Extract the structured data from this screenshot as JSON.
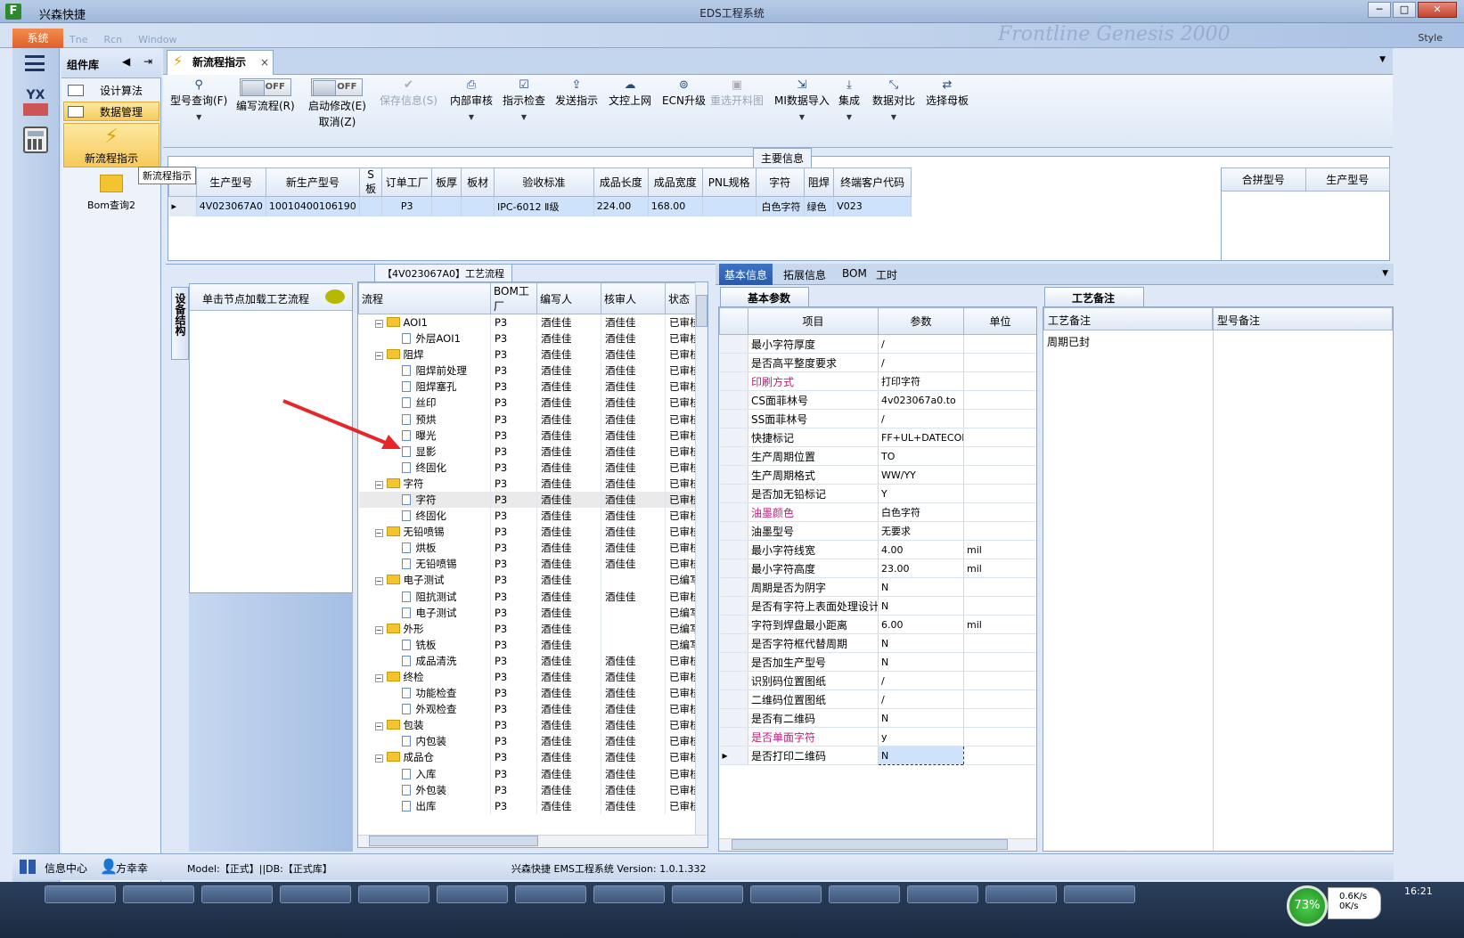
{
  "window": {
    "app_name": "兴森快捷",
    "title": "EDS工程系统",
    "style_label": "Style",
    "banner_text": "Frontline Genesis 2000"
  },
  "menu": {
    "system_button": "系统",
    "faint_items": [
      "Tne",
      "Rcn",
      "Window"
    ]
  },
  "component_library": {
    "title": "组件库",
    "items": [
      {
        "label": "设计算法"
      },
      {
        "label": "数据管理"
      },
      {
        "label": "新流程指示"
      },
      {
        "label": "Bom查询2"
      }
    ],
    "tooltip": "新流程指示"
  },
  "tab": {
    "label": "新流程指示"
  },
  "toolbar": {
    "buttons": [
      {
        "label": "型号查询(F)",
        "icon": "search-icon"
      },
      {
        "label": "编写流程(R)",
        "toggle": "OFF"
      },
      {
        "label": "启动修改(E)",
        "label2": "取消(Z)",
        "toggle": "OFF"
      },
      {
        "label": "保存信息(S)",
        "icon": "check-icon",
        "disabled": true
      },
      {
        "label": "内部审核",
        "icon": "printer-icon"
      },
      {
        "label": "指示检查",
        "icon": "checkbox-icon"
      },
      {
        "label": "发送指示",
        "icon": "upload-icon"
      },
      {
        "label": "文控上网",
        "icon": "cloud-upload-icon"
      },
      {
        "label": "ECN升级",
        "icon": "binoculars-icon"
      },
      {
        "label": "重选开料图",
        "icon": "image-icon",
        "disabled": true
      },
      {
        "label": "MI数据导入",
        "icon": "import-icon"
      },
      {
        "label": "集成",
        "icon": "download-icon"
      },
      {
        "label": "数据对比",
        "icon": "compress-icon"
      },
      {
        "label": "选择母板",
        "icon": "shuffle-icon"
      }
    ]
  },
  "main_info": {
    "title": "主要信息",
    "columns": [
      "生产型号",
      "新生产型号",
      "S板",
      "订单工厂",
      "板厚",
      "板材",
      "验收标准",
      "成品长度",
      "成品宽度",
      "PNL规格",
      "字符",
      "阻焊",
      "终端客户代码"
    ],
    "rows": [
      [
        "4V023067A0",
        "10010400106190",
        "",
        "P3",
        "",
        "",
        "IPC-6012 Ⅱ级",
        "224.00",
        "168.00",
        "",
        "白色字符",
        "绿色",
        "V023"
      ]
    ],
    "side_columns": [
      "合拼型号",
      "生产型号"
    ]
  },
  "left_panel": {
    "vertical_tab": "设备结构",
    "hint": "单击节点加载工艺流程"
  },
  "flow": {
    "title": "【4V023067A0】工艺流程",
    "columns": [
      "流程",
      "BOM工厂",
      "编写人",
      "核审人",
      "状态"
    ],
    "rows": [
      {
        "name": "AOI1",
        "level": 0,
        "folder": true,
        "factory": "P3",
        "writer": "酒佳佳",
        "reviewer": "酒佳佳",
        "status": "已审核"
      },
      {
        "name": "外层AOI1",
        "level": 1,
        "factory": "P3",
        "writer": "酒佳佳",
        "reviewer": "酒佳佳",
        "status": "已审核"
      },
      {
        "name": "阻焊",
        "level": 0,
        "folder": true,
        "factory": "P3",
        "writer": "酒佳佳",
        "reviewer": "酒佳佳",
        "status": "已审核"
      },
      {
        "name": "阻焊前处理",
        "level": 1,
        "factory": "P3",
        "writer": "酒佳佳",
        "reviewer": "酒佳佳",
        "status": "已审核"
      },
      {
        "name": "阻焊塞孔",
        "level": 1,
        "factory": "P3",
        "writer": "酒佳佳",
        "reviewer": "酒佳佳",
        "status": "已审核"
      },
      {
        "name": "丝印",
        "level": 1,
        "factory": "P3",
        "writer": "酒佳佳",
        "reviewer": "酒佳佳",
        "status": "已审核"
      },
      {
        "name": "预烘",
        "level": 1,
        "factory": "P3",
        "writer": "酒佳佳",
        "reviewer": "酒佳佳",
        "status": "已审核"
      },
      {
        "name": "曝光",
        "level": 1,
        "factory": "P3",
        "writer": "酒佳佳",
        "reviewer": "酒佳佳",
        "status": "已审核"
      },
      {
        "name": "显影",
        "level": 1,
        "factory": "P3",
        "writer": "酒佳佳",
        "reviewer": "酒佳佳",
        "status": "已审核"
      },
      {
        "name": "终固化",
        "level": 1,
        "factory": "P3",
        "writer": "酒佳佳",
        "reviewer": "酒佳佳",
        "status": "已审核"
      },
      {
        "name": "字符",
        "level": 0,
        "folder": true,
        "factory": "P3",
        "writer": "酒佳佳",
        "reviewer": "酒佳佳",
        "status": "已审核"
      },
      {
        "name": "字符",
        "level": 1,
        "factory": "P3",
        "writer": "酒佳佳",
        "reviewer": "酒佳佳",
        "status": "已审核",
        "selected": true
      },
      {
        "name": "终固化",
        "level": 1,
        "factory": "P3",
        "writer": "酒佳佳",
        "reviewer": "酒佳佳",
        "status": "已审核"
      },
      {
        "name": "无铅喷锡",
        "level": 0,
        "folder": true,
        "factory": "P3",
        "writer": "酒佳佳",
        "reviewer": "酒佳佳",
        "status": "已审核"
      },
      {
        "name": "烘板",
        "level": 1,
        "factory": "P3",
        "writer": "酒佳佳",
        "reviewer": "酒佳佳",
        "status": "已审核"
      },
      {
        "name": "无铅喷锡",
        "level": 1,
        "factory": "P3",
        "writer": "酒佳佳",
        "reviewer": "酒佳佳",
        "status": "已审核"
      },
      {
        "name": "电子测试",
        "level": 0,
        "folder": true,
        "factory": "P3",
        "writer": "酒佳佳",
        "reviewer": "",
        "status": "已编写"
      },
      {
        "name": "阻抗测试",
        "level": 1,
        "factory": "P3",
        "writer": "酒佳佳",
        "reviewer": "酒佳佳",
        "status": "已审核"
      },
      {
        "name": "电子测试",
        "level": 1,
        "factory": "P3",
        "writer": "酒佳佳",
        "reviewer": "",
        "status": "已编写"
      },
      {
        "name": "外形",
        "level": 0,
        "folder": true,
        "factory": "P3",
        "writer": "酒佳佳",
        "reviewer": "",
        "status": "已编写"
      },
      {
        "name": "铣板",
        "level": 1,
        "factory": "P3",
        "writer": "酒佳佳",
        "reviewer": "",
        "status": "已编写"
      },
      {
        "name": "成品清洗",
        "level": 1,
        "factory": "P3",
        "writer": "酒佳佳",
        "reviewer": "酒佳佳",
        "status": "已审核"
      },
      {
        "name": "终检",
        "level": 0,
        "folder": true,
        "factory": "P3",
        "writer": "酒佳佳",
        "reviewer": "酒佳佳",
        "status": "已审核"
      },
      {
        "name": "功能检查",
        "level": 1,
        "factory": "P3",
        "writer": "酒佳佳",
        "reviewer": "酒佳佳",
        "status": "已审核"
      },
      {
        "name": "外观检查",
        "level": 1,
        "factory": "P3",
        "writer": "酒佳佳",
        "reviewer": "酒佳佳",
        "status": "已审核"
      },
      {
        "name": "包装",
        "level": 0,
        "folder": true,
        "factory": "P3",
        "writer": "酒佳佳",
        "reviewer": "酒佳佳",
        "status": "已审核"
      },
      {
        "name": "内包装",
        "level": 1,
        "factory": "P3",
        "writer": "酒佳佳",
        "reviewer": "酒佳佳",
        "status": "已审核"
      },
      {
        "name": "成品仓",
        "level": 0,
        "folder": true,
        "factory": "P3",
        "writer": "酒佳佳",
        "reviewer": "酒佳佳",
        "status": "已审核"
      },
      {
        "name": "入库",
        "level": 1,
        "factory": "P3",
        "writer": "酒佳佳",
        "reviewer": "酒佳佳",
        "status": "已审核"
      },
      {
        "name": "外包装",
        "level": 1,
        "factory": "P3",
        "writer": "酒佳佳",
        "reviewer": "酒佳佳",
        "status": "已审核"
      },
      {
        "name": "出库",
        "level": 1,
        "factory": "P3",
        "writer": "酒佳佳",
        "reviewer": "酒佳佳",
        "status": "已审核"
      }
    ]
  },
  "detail_tabs": [
    "基本信息",
    "拓展信息",
    "BOM",
    "工时"
  ],
  "params": {
    "tab": "基本参数",
    "columns": [
      "项目",
      "参数",
      "单位"
    ],
    "rows": [
      {
        "item": "最小字符厚度",
        "value": "/",
        "unit": ""
      },
      {
        "item": "是否高平整度要求",
        "value": "/",
        "unit": ""
      },
      {
        "item": "印刷方式",
        "value": "打印字符",
        "unit": "",
        "highlight": true
      },
      {
        "item": "CS面菲林号",
        "value": "4v023067a0.to",
        "unit": ""
      },
      {
        "item": "SS面菲林号",
        "value": "/",
        "unit": ""
      },
      {
        "item": "快捷标记",
        "value": "FF+UL+DATECODE",
        "unit": ""
      },
      {
        "item": "生产周期位置",
        "value": "TO",
        "unit": ""
      },
      {
        "item": "生产周期格式",
        "value": "WW/YY",
        "unit": ""
      },
      {
        "item": "是否加无铅标记",
        "value": "Y",
        "unit": ""
      },
      {
        "item": "油墨颜色",
        "value": "白色字符",
        "unit": "",
        "highlight": true
      },
      {
        "item": "油墨型号",
        "value": "无要求",
        "unit": ""
      },
      {
        "item": "最小字符线宽",
        "value": "4.00",
        "unit": "mil"
      },
      {
        "item": "最小字符高度",
        "value": "23.00",
        "unit": "mil"
      },
      {
        "item": "周期是否为阴字",
        "value": "N",
        "unit": ""
      },
      {
        "item": "是否有字符上表面处理设计",
        "value": "N",
        "unit": ""
      },
      {
        "item": "字符到焊盘最小距离",
        "value": "6.00",
        "unit": "mil"
      },
      {
        "item": "是否字符框代替周期",
        "value": "N",
        "unit": ""
      },
      {
        "item": "是否加生产型号",
        "value": "N",
        "unit": ""
      },
      {
        "item": "识别码位置图纸",
        "value": "/",
        "unit": ""
      },
      {
        "item": "二维码位置图纸",
        "value": "/",
        "unit": ""
      },
      {
        "item": "是否有二维码",
        "value": "N",
        "unit": ""
      },
      {
        "item": "是否单面字符",
        "value": "y",
        "unit": "",
        "highlight": true
      },
      {
        "item": "是否打印二维码",
        "value": "N",
        "unit": "",
        "selected": true
      }
    ]
  },
  "remarks": {
    "tab": "工艺备注",
    "columns": [
      "工艺备注",
      "型号备注"
    ],
    "process_note": "周期已封",
    "model_note": ""
  },
  "status": {
    "info_center": "信息中心",
    "user": "方幸幸",
    "model": "Model:【正式】||DB:【正式库】",
    "version": "兴森快捷 EMS工程系统 Version: 1.0.1.332"
  },
  "tray": {
    "cpu": "73%",
    "up": "0.6K/s",
    "down": "0K/s",
    "time": "16:21"
  },
  "colors": {
    "highlight_text": "#c0207a",
    "accent_orange": "#e86c34",
    "arrow_red": "#e8262a"
  }
}
